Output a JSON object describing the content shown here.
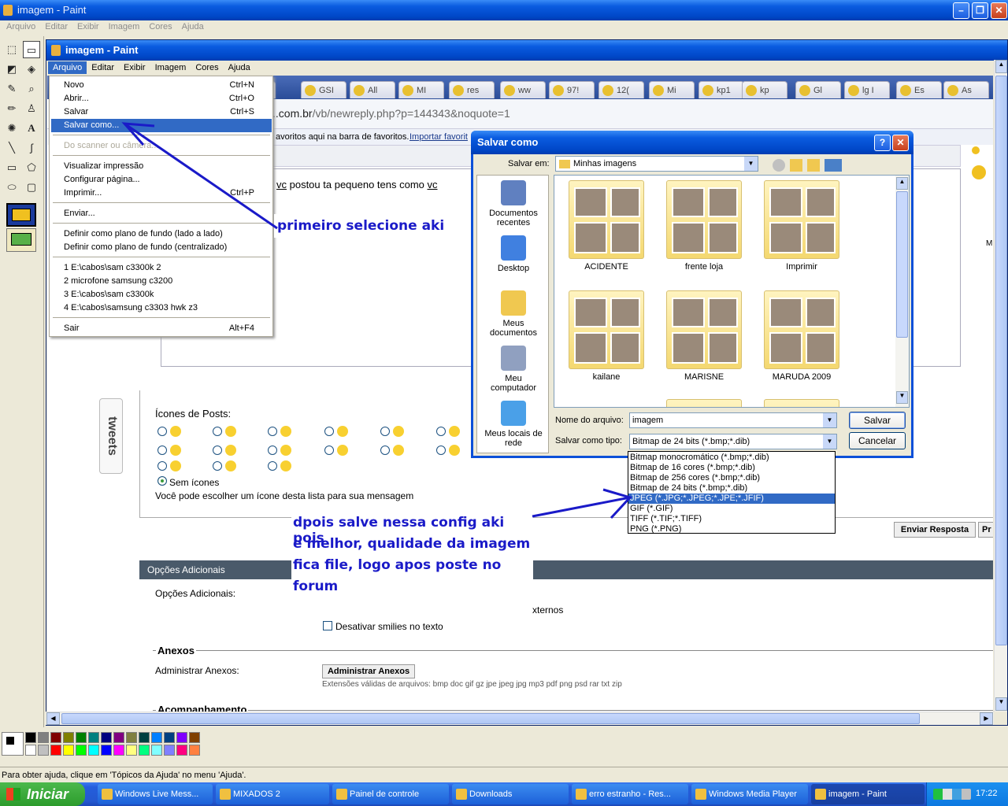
{
  "outer_window": {
    "title": "imagem - Paint"
  },
  "outer_menu": [
    "Arquivo",
    "Editar",
    "Exibir",
    "Imagem",
    "Cores",
    "Ajuda"
  ],
  "inner_window": {
    "title": "imagem - Paint"
  },
  "inner_menu": [
    "Arquivo",
    "Editar",
    "Exibir",
    "Imagem",
    "Cores",
    "Ajuda"
  ],
  "arquivo_menu": [
    {
      "label": "Novo",
      "shortcut": "Ctrl+N"
    },
    {
      "label": "Abrir...",
      "shortcut": "Ctrl+O"
    },
    {
      "label": "Salvar",
      "shortcut": "Ctrl+S"
    },
    {
      "label": "Salvar como...",
      "shortcut": ""
    },
    {
      "label": "Do scanner ou câmera...",
      "shortcut": ""
    },
    {
      "label": "Visualizar impressão",
      "shortcut": ""
    },
    {
      "label": "Configurar página...",
      "shortcut": ""
    },
    {
      "label": "Imprimir...",
      "shortcut": "Ctrl+P"
    },
    {
      "label": "Enviar...",
      "shortcut": ""
    },
    {
      "label": "Definir como plano de fundo (lado a lado)",
      "shortcut": ""
    },
    {
      "label": "Definir como plano de fundo (centralizado)",
      "shortcut": ""
    },
    {
      "label": "1 E:\\cabos\\sam c3300k  2",
      "shortcut": ""
    },
    {
      "label": "2 microfone samsung c3200",
      "shortcut": ""
    },
    {
      "label": "3 E:\\cabos\\sam c3300k",
      "shortcut": ""
    },
    {
      "label": "4 E:\\cabos\\samsung c3303 hwk z3",
      "shortcut": ""
    },
    {
      "label": "Sair",
      "shortcut": "Alt+F4"
    }
  ],
  "browser": {
    "tabs": [
      "ht",
      "GSI",
      "All",
      "MI",
      "res",
      "ww",
      "97!",
      "12(",
      "Mi",
      "kp1",
      "kp",
      "Gl",
      "lg I",
      "Es",
      "As"
    ],
    "url_prefix": "..com.br",
    "url_rest": "/vb/newreply.php?p=144343&noquote=1",
    "favorites_text": "avoritos aqui na barra de favoritos.",
    "favorites_link": "Importar favorit",
    "post_text_pre": "vc",
    "post_text_mid": " postou ta pequeno tens como ",
    "post_text_post": "vc",
    "icons_heading": "Ícones de Posts:",
    "no_icons": "Sem ícones",
    "icons_hint": "Você pode escolher um ícone desta lista para sua mensagem",
    "send_button": "Enviar Resposta",
    "preview_button": "Pr",
    "additional_header": "Opções Adicionais",
    "additional_label": "Opções Adicionais:",
    "external_text": "xternos",
    "disable_smilies": "Desativar smilies no texto",
    "attachments_section": "Anexos",
    "manage_attachments_label": "Administrar Anexos:",
    "manage_attachments_button": "Administrar Anexos",
    "valid_ext": "Extensões válidas de arquivos: bmp doc gif gz jpe jpeg jpg mp3 pdf png psd rar txt zip",
    "follow_section": "Acompanhamento",
    "tweets": "tweets",
    "side_letter": "M"
  },
  "dialog": {
    "title": "Salvar como",
    "save_in_label": "Salvar em:",
    "save_in_value": "Minhas imagens",
    "places": [
      "Documentos recentes",
      "Desktop",
      "Meus documentos",
      "Meu computador",
      "Meus locais de rede"
    ],
    "folders": [
      "ACIDENTE",
      "frente loja",
      "Imprimir",
      "kailane",
      "MARISNE",
      "MARUDA 2009"
    ],
    "filename_label": "Nome do arquivo:",
    "filename_value": "imagem",
    "type_label": "Salvar como tipo:",
    "type_value": "Bitmap de 24 bits (*.bmp;*.dib)",
    "type_options": [
      "Bitmap monocromático (*.bmp;*.dib)",
      "Bitmap de 16 cores (*.bmp;*.dib)",
      "Bitmap de 256 cores (*.bmp;*.dib)",
      "Bitmap de 24 bits (*.bmp;*.dib)",
      "JPEG (*.JPG;*.JPEG;*.JPE;*.JFIF)",
      "GIF (*.GIF)",
      "TIFF (*.TIF;*.TIFF)",
      "PNG (*.PNG)"
    ],
    "save_button": "Salvar",
    "cancel_button": "Cancelar"
  },
  "annotations": {
    "first": "primeiro selecione aki",
    "second": [
      "dpois salve nessa config aki pois",
      "e melhor, qualidade da imagem",
      "fica file, logo apos poste no",
      "forum"
    ]
  },
  "status_bar": "Para obter ajuda, clique em 'Tópicos da Ajuda' no menu 'Ajuda'.",
  "taskbar": {
    "start": "Iniciar",
    "items": [
      "Windows Live Mess...",
      "MIXADOS 2",
      "Painel de controle",
      "Downloads",
      "erro estranho - Res...",
      "Windows Media Player",
      "imagem - Paint"
    ],
    "clock": "17:22"
  },
  "palette": [
    "#000000",
    "#808080",
    "#800000",
    "#808000",
    "#008000",
    "#008080",
    "#000080",
    "#800080",
    "#808040",
    "#004040",
    "#0080ff",
    "#004080",
    "#8000ff",
    "#804000",
    "#ffffff",
    "#c0c0c0",
    "#ff0000",
    "#ffff00",
    "#00ff00",
    "#00ffff",
    "#0000ff",
    "#ff00ff",
    "#ffff80",
    "#00ff80",
    "#80ffff",
    "#8080ff",
    "#ff0080",
    "#ff8040"
  ]
}
